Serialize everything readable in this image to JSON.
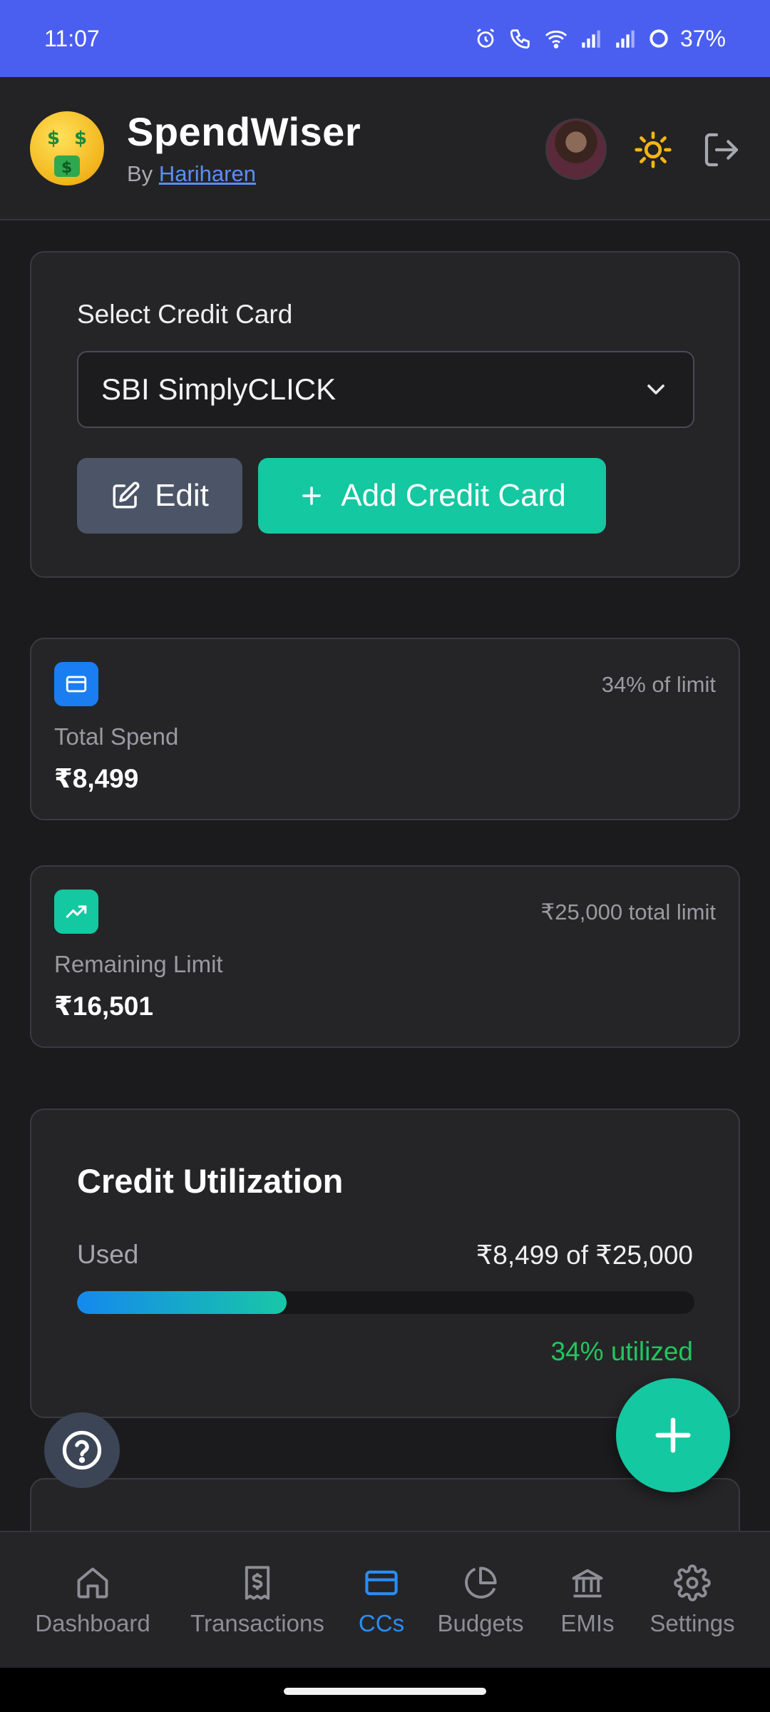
{
  "status_bar": {
    "time": "11:07",
    "battery": "37%"
  },
  "header": {
    "app_name": "SpendWiser",
    "by_prefix": "By",
    "author": "Hariharen",
    "logo_icon": "money-mouth-face-emoji",
    "theme_icon": "sun-icon",
    "logout_icon": "logout-icon"
  },
  "card_select": {
    "label": "Select Credit Card",
    "selected": "SBI SimplyCLICK",
    "edit_label": "Edit",
    "add_label": "Add Credit Card"
  },
  "total_spend": {
    "note": "34% of limit",
    "label": "Total Spend",
    "value": "₹8,499",
    "icon": "credit-card-icon",
    "icon_color": "#1a7ef2"
  },
  "remaining_limit": {
    "note": "₹25,000 total limit",
    "label": "Remaining Limit",
    "value": "₹16,501",
    "icon": "trending-up-icon",
    "icon_color": "#14c8a1"
  },
  "utilization": {
    "title": "Credit Utilization",
    "used_label": "Used",
    "amount": "₹8,499 of ₹25,000",
    "percent": 34,
    "percent_label": "34% utilized"
  },
  "nav": {
    "items": [
      {
        "label": "Dashboard",
        "icon": "home-icon",
        "active": false
      },
      {
        "label": "Transactions",
        "icon": "receipt-icon",
        "active": false
      },
      {
        "label": "CCs",
        "icon": "credit-card-icon",
        "active": true
      },
      {
        "label": "Budgets",
        "icon": "pie-chart-icon",
        "active": false
      },
      {
        "label": "EMIs",
        "icon": "bank-icon",
        "active": false
      },
      {
        "label": "Settings",
        "icon": "gear-icon",
        "active": false
      }
    ]
  },
  "colors": {
    "accent_teal": "#14c8a1",
    "accent_blue": "#2a8df7",
    "status_bar": "#4a5ff0",
    "success_green": "#22c55e"
  }
}
